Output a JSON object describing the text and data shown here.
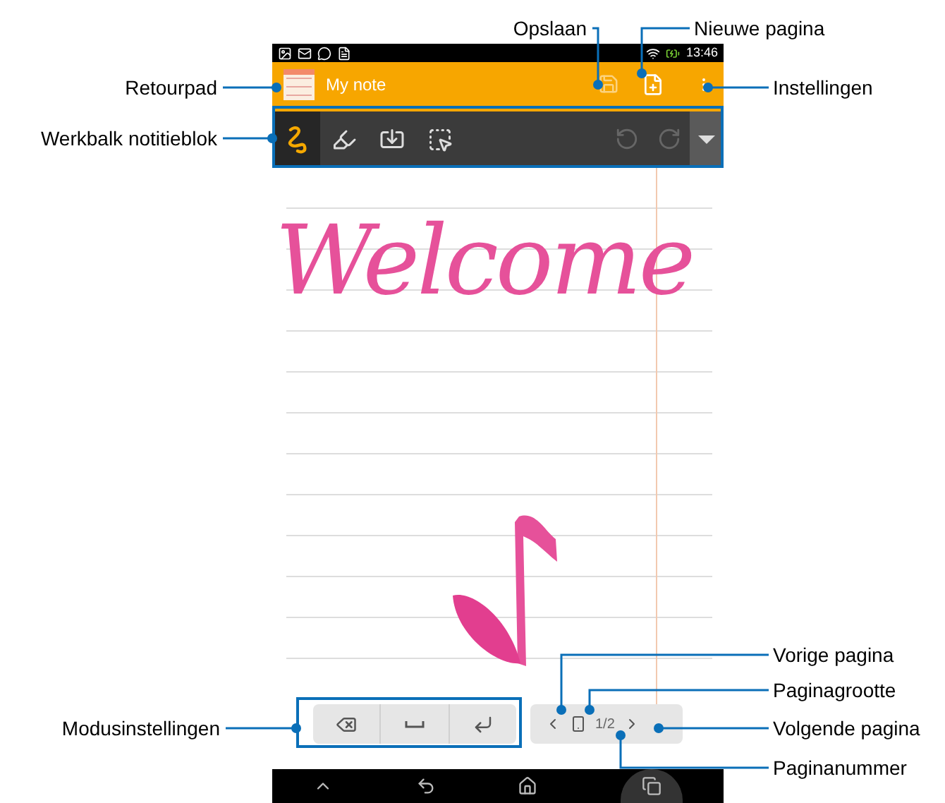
{
  "status_bar": {
    "time": "13:46"
  },
  "app_bar": {
    "title": "My note"
  },
  "toolbar": {
    "tools": [
      {
        "kind": "pen",
        "selected": true
      },
      {
        "kind": "highlighter",
        "selected": false
      },
      {
        "kind": "import",
        "selected": false
      },
      {
        "kind": "select",
        "selected": false
      }
    ],
    "history": [
      {
        "kind": "undo",
        "disabled": true
      },
      {
        "kind": "redo",
        "disabled": true
      }
    ]
  },
  "note": {
    "handwriting": "Welcome"
  },
  "mode_keys": [
    {
      "kind": "backspace"
    },
    {
      "kind": "space"
    },
    {
      "kind": "enter"
    }
  ],
  "pager": {
    "page": "1/2"
  },
  "callouts": [
    {
      "label": "Opslaan"
    },
    {
      "label": "Nieuwe pagina"
    },
    {
      "label": "Retourpad"
    },
    {
      "label": "Instellingen"
    },
    {
      "label": "Werkbalk notitieblok"
    },
    {
      "label": "Vorige pagina"
    },
    {
      "label": "Paginagrootte"
    },
    {
      "label": "Modusinstellingen"
    },
    {
      "label": "Volgende pagina"
    },
    {
      "label": "Paginanummer"
    }
  ]
}
